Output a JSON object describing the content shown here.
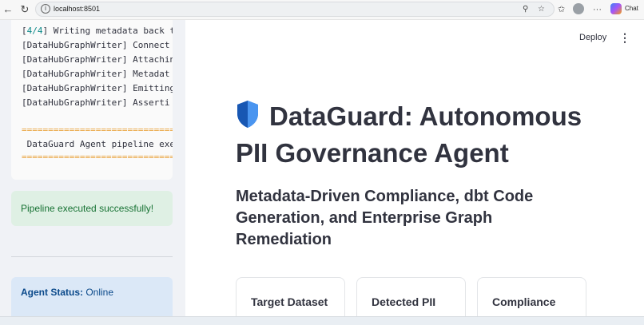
{
  "browser": {
    "url": "localhost:8501",
    "chat_label": "Chat"
  },
  "sidebar": {
    "log_lines": [
      {
        "prefix": "[",
        "num": "4/4",
        "text": "] Writing metadata back t"
      },
      {
        "prefix": "[DataHubGraphWriter] ",
        "num": "",
        "text": "Connect"
      },
      {
        "prefix": "[DataHubGraphWriter] ",
        "num": "",
        "text": "Attachin"
      },
      {
        "prefix": "[DataHubGraphWriter] ",
        "num": "",
        "text": "Metadat"
      },
      {
        "prefix": "[DataHubGraphWriter] ",
        "num": "",
        "text": "Emitting"
      },
      {
        "prefix": "[DataHubGraphWriter] ",
        "num": "",
        "text": "Asserti"
      }
    ],
    "rule": "===============================",
    "banner": " DataGuard Agent pipeline exe",
    "success_message": "Pipeline executed successfully!",
    "status_label": "Agent Status:",
    "status_value": "Online"
  },
  "header": {
    "deploy_label": "Deploy",
    "menu_icon": "kebab-menu-icon"
  },
  "main": {
    "title_icon": "shield-icon",
    "title": "DataGuard: Autonomous PII Governance Agent",
    "subtitle": "Metadata-Driven Compliance, dbt Code Generation, and Enterprise Graph Remediation",
    "cards": [
      {
        "label": "Target Dataset"
      },
      {
        "label": "Detected PII"
      },
      {
        "label": "Compliance"
      }
    ]
  },
  "colors": {
    "sidebar_bg": "#f0f2f6",
    "success_bg": "#dff0e4",
    "success_text": "#177233",
    "info_bg": "#dbe8f7",
    "info_text": "#0b4a8b",
    "rule_color": "#e9a23b",
    "shield_blue": "#1e6fd9"
  }
}
